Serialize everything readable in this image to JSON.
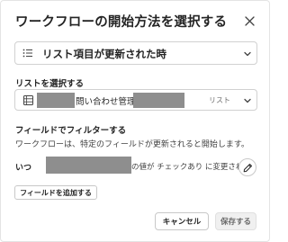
{
  "dialog": {
    "title": "ワークフローの開始方法を選択する",
    "close_icon": "close-icon"
  },
  "trigger": {
    "icon": "list-icon",
    "value": "リスト項目が更新された時"
  },
  "list_section": {
    "label": "リストを選択する",
    "icon": "list-grid-icon",
    "list_name": "問い合わせ管理",
    "list_kind": "リスト"
  },
  "filter_section": {
    "label": "フィールドでフィルターする",
    "description": "ワークフローは、特定のフィールドが更新されると開始します。",
    "when_label": "いつ",
    "condition_text": "の値が チェックあり に変更された",
    "edit_icon": "pencil-icon",
    "add_filter_label": "フィールドを追加する"
  },
  "footer": {
    "cancel_label": "キャンセル",
    "save_label": "保存する"
  }
}
